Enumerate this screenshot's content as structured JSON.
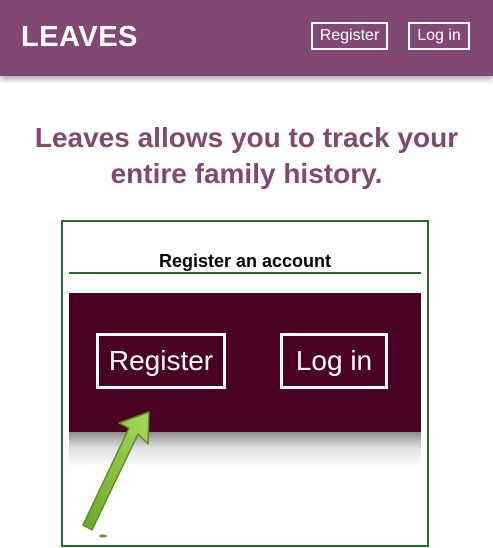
{
  "header": {
    "brand": "LEAVES",
    "register_label": "Register",
    "login_label": "Log in",
    "background_color": "#824874"
  },
  "hero": {
    "headline": "Leaves allows you to track your entire family history.",
    "headline_color": "#824874"
  },
  "tutorial": {
    "title": "Register an account",
    "zoomed_header": {
      "register_label": "Register",
      "login_label": "Log in",
      "background_color": "#4a0022"
    },
    "border_color": "#256b25",
    "arrow_color": "#8cc63f",
    "arrow_icon": "green-arrow-pointing-up-right"
  }
}
